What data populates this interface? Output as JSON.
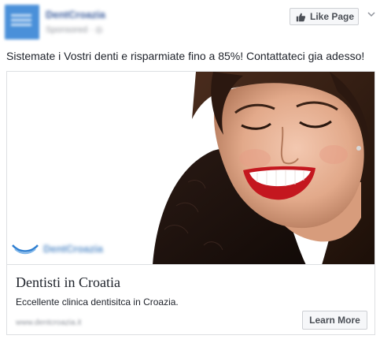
{
  "header": {
    "page_name": "DentCroazia",
    "sponsored_label": "Sponsored · ",
    "like_button_label": "Like Page",
    "avatar_icon": "clinic-logo-icon"
  },
  "post": {
    "text": "Sistemate i Vostri denti e risparmiate fino a 85%! Contattateci gia adesso!"
  },
  "media": {
    "image_subject": "smiling-woman-photo",
    "logo_text": "DentCroazia"
  },
  "link": {
    "title": "Dentisti in Croatia",
    "description": "Eccellente clinica dentisitca in Croazia.",
    "domain": "www.dentcroazia.it",
    "cta_label": "Learn More"
  },
  "colors": {
    "brand_blue": "#365899",
    "border": "#dddfe2",
    "button_bg": "#f6f7f9",
    "text": "#1d2129",
    "muted": "#90949c"
  }
}
